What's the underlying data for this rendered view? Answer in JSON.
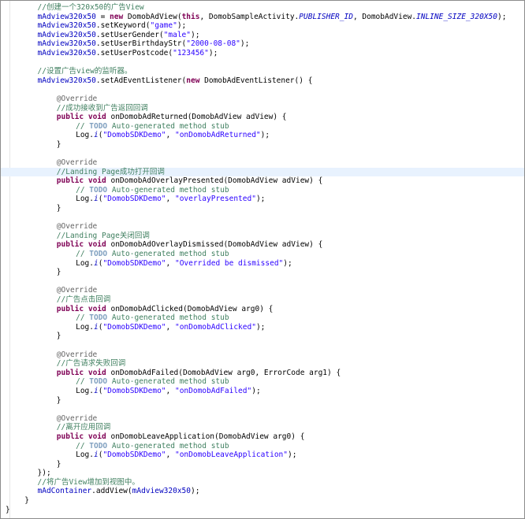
{
  "editor": {
    "lines": [
      {
        "indent": 5,
        "tokens": [
          {
            "k": "cmt",
            "t": "//创建一个320x50的广告View"
          }
        ]
      },
      {
        "indent": 5,
        "tokens": [
          {
            "k": "var",
            "t": "mAdview320x50"
          },
          {
            "k": "plain",
            "t": " = "
          },
          {
            "k": "kw",
            "t": "new"
          },
          {
            "k": "plain",
            "t": " DomobAdView("
          },
          {
            "k": "kw",
            "t": "this"
          },
          {
            "k": "plain",
            "t": ", DomobSampleActivity."
          },
          {
            "k": "field",
            "t": "PUBLISHER_ID"
          },
          {
            "k": "plain",
            "t": ", DomobAdView."
          },
          {
            "k": "field",
            "t": "INLINE_SIZE_320X50"
          },
          {
            "k": "plain",
            "t": ");"
          }
        ]
      },
      {
        "indent": 5,
        "tokens": [
          {
            "k": "var",
            "t": "mAdview320x50"
          },
          {
            "k": "plain",
            "t": ".setKeyword("
          },
          {
            "k": "str",
            "t": "\"game\""
          },
          {
            "k": "plain",
            "t": ");"
          }
        ]
      },
      {
        "indent": 5,
        "tokens": [
          {
            "k": "var",
            "t": "mAdview320x50"
          },
          {
            "k": "plain",
            "t": ".setUserGender("
          },
          {
            "k": "str",
            "t": "\"male\""
          },
          {
            "k": "plain",
            "t": ");"
          }
        ]
      },
      {
        "indent": 5,
        "tokens": [
          {
            "k": "var",
            "t": "mAdview320x50"
          },
          {
            "k": "plain",
            "t": ".setUserBirthdayStr("
          },
          {
            "k": "str",
            "t": "\"2000-08-08\""
          },
          {
            "k": "plain",
            "t": ");"
          }
        ]
      },
      {
        "indent": 5,
        "tokens": [
          {
            "k": "var",
            "t": "mAdview320x50"
          },
          {
            "k": "plain",
            "t": ".setUserPostcode("
          },
          {
            "k": "str",
            "t": "\"123456\""
          },
          {
            "k": "plain",
            "t": ");"
          }
        ]
      },
      {
        "indent": 0,
        "tokens": []
      },
      {
        "indent": 5,
        "tokens": [
          {
            "k": "cmt",
            "t": "//设置广告view的监听器。"
          }
        ]
      },
      {
        "indent": 5,
        "tokens": [
          {
            "k": "var",
            "t": "mAdview320x50"
          },
          {
            "k": "plain",
            "t": ".setAdEventListener("
          },
          {
            "k": "kw",
            "t": "new"
          },
          {
            "k": "plain",
            "t": " DomobAdEventListener() {"
          }
        ]
      },
      {
        "indent": 0,
        "tokens": []
      },
      {
        "indent": 8,
        "tokens": [
          {
            "k": "ann",
            "t": "@Override"
          }
        ]
      },
      {
        "indent": 8,
        "tokens": [
          {
            "k": "cmt",
            "t": "//成功接收到广告返回回调"
          }
        ]
      },
      {
        "indent": 8,
        "tokens": [
          {
            "k": "kw",
            "t": "public"
          },
          {
            "k": "plain",
            "t": " "
          },
          {
            "k": "kw",
            "t": "void"
          },
          {
            "k": "plain",
            "t": " onDomobAdReturned(DomobAdView adView) {"
          }
        ]
      },
      {
        "indent": 11,
        "tokens": [
          {
            "k": "cmt",
            "t": "// "
          },
          {
            "k": "todo",
            "t": "TODO"
          },
          {
            "k": "cmt",
            "t": " Auto-generated method stub"
          }
        ]
      },
      {
        "indent": 11,
        "tokens": [
          {
            "k": "plain",
            "t": "Log."
          },
          {
            "k": "field",
            "t": "i"
          },
          {
            "k": "plain",
            "t": "("
          },
          {
            "k": "str",
            "t": "\"DomobSDKDemo\""
          },
          {
            "k": "plain",
            "t": ", "
          },
          {
            "k": "str",
            "t": "\"onDomobAdReturned\""
          },
          {
            "k": "plain",
            "t": ");"
          }
        ]
      },
      {
        "indent": 8,
        "tokens": [
          {
            "k": "plain",
            "t": "}"
          }
        ]
      },
      {
        "indent": 0,
        "tokens": []
      },
      {
        "indent": 8,
        "tokens": [
          {
            "k": "ann",
            "t": "@Override"
          }
        ]
      },
      {
        "indent": 8,
        "hl": true,
        "tokens": [
          {
            "k": "cmt",
            "t": "//Landing Page成功打开回调"
          }
        ]
      },
      {
        "indent": 8,
        "tokens": [
          {
            "k": "kw",
            "t": "public"
          },
          {
            "k": "plain",
            "t": " "
          },
          {
            "k": "kw",
            "t": "void"
          },
          {
            "k": "plain",
            "t": " onDomobAdOverlayPresented(DomobAdView adView) {"
          }
        ]
      },
      {
        "indent": 11,
        "tokens": [
          {
            "k": "cmt",
            "t": "// "
          },
          {
            "k": "todo",
            "t": "TODO"
          },
          {
            "k": "cmt",
            "t": " Auto-generated method stub"
          }
        ]
      },
      {
        "indent": 11,
        "tokens": [
          {
            "k": "plain",
            "t": "Log."
          },
          {
            "k": "field",
            "t": "i"
          },
          {
            "k": "plain",
            "t": "("
          },
          {
            "k": "str",
            "t": "\"DomobSDKDemo\""
          },
          {
            "k": "plain",
            "t": ", "
          },
          {
            "k": "str",
            "t": "\"overlayPresented\""
          },
          {
            "k": "plain",
            "t": ");"
          }
        ]
      },
      {
        "indent": 8,
        "tokens": [
          {
            "k": "plain",
            "t": "}"
          }
        ]
      },
      {
        "indent": 0,
        "tokens": []
      },
      {
        "indent": 8,
        "tokens": [
          {
            "k": "ann",
            "t": "@Override"
          }
        ]
      },
      {
        "indent": 8,
        "tokens": [
          {
            "k": "cmt",
            "t": "//Landing Page关闭回调"
          }
        ]
      },
      {
        "indent": 8,
        "tokens": [
          {
            "k": "kw",
            "t": "public"
          },
          {
            "k": "plain",
            "t": " "
          },
          {
            "k": "kw",
            "t": "void"
          },
          {
            "k": "plain",
            "t": " onDomobAdOverlayDismissed(DomobAdView adView) {"
          }
        ]
      },
      {
        "indent": 11,
        "tokens": [
          {
            "k": "cmt",
            "t": "// "
          },
          {
            "k": "todo",
            "t": "TODO"
          },
          {
            "k": "cmt",
            "t": " Auto-generated method stub"
          }
        ]
      },
      {
        "indent": 11,
        "tokens": [
          {
            "k": "plain",
            "t": "Log."
          },
          {
            "k": "field",
            "t": "i"
          },
          {
            "k": "plain",
            "t": "("
          },
          {
            "k": "str",
            "t": "\"DomobSDKDemo\""
          },
          {
            "k": "plain",
            "t": ", "
          },
          {
            "k": "str",
            "t": "\"Overrided be dismissed\""
          },
          {
            "k": "plain",
            "t": ");"
          }
        ]
      },
      {
        "indent": 8,
        "tokens": [
          {
            "k": "plain",
            "t": "}"
          }
        ]
      },
      {
        "indent": 0,
        "tokens": []
      },
      {
        "indent": 8,
        "tokens": [
          {
            "k": "ann",
            "t": "@Override"
          }
        ]
      },
      {
        "indent": 8,
        "tokens": [
          {
            "k": "cmt",
            "t": "//广告点击回调"
          }
        ]
      },
      {
        "indent": 8,
        "tokens": [
          {
            "k": "kw",
            "t": "public"
          },
          {
            "k": "plain",
            "t": " "
          },
          {
            "k": "kw",
            "t": "void"
          },
          {
            "k": "plain",
            "t": " onDomobAdClicked(DomobAdView arg0) {"
          }
        ]
      },
      {
        "indent": 11,
        "tokens": [
          {
            "k": "cmt",
            "t": "// "
          },
          {
            "k": "todo",
            "t": "TODO"
          },
          {
            "k": "cmt",
            "t": " Auto-generated method stub"
          }
        ]
      },
      {
        "indent": 11,
        "tokens": [
          {
            "k": "plain",
            "t": "Log."
          },
          {
            "k": "field",
            "t": "i"
          },
          {
            "k": "plain",
            "t": "("
          },
          {
            "k": "str",
            "t": "\"DomobSDKDemo\""
          },
          {
            "k": "plain",
            "t": ", "
          },
          {
            "k": "str",
            "t": "\"onDomobAdClicked\""
          },
          {
            "k": "plain",
            "t": ");"
          }
        ]
      },
      {
        "indent": 8,
        "tokens": [
          {
            "k": "plain",
            "t": "}"
          }
        ]
      },
      {
        "indent": 0,
        "tokens": []
      },
      {
        "indent": 8,
        "tokens": [
          {
            "k": "ann",
            "t": "@Override"
          }
        ]
      },
      {
        "indent": 8,
        "tokens": [
          {
            "k": "cmt",
            "t": "//广告请求失败回调"
          }
        ]
      },
      {
        "indent": 8,
        "tokens": [
          {
            "k": "kw",
            "t": "public"
          },
          {
            "k": "plain",
            "t": " "
          },
          {
            "k": "kw",
            "t": "void"
          },
          {
            "k": "plain",
            "t": " onDomobAdFailed(DomobAdView arg0, ErrorCode arg1) {"
          }
        ]
      },
      {
        "indent": 11,
        "tokens": [
          {
            "k": "cmt",
            "t": "// "
          },
          {
            "k": "todo",
            "t": "TODO"
          },
          {
            "k": "cmt",
            "t": " Auto-generated method stub"
          }
        ]
      },
      {
        "indent": 11,
        "tokens": [
          {
            "k": "plain",
            "t": "Log."
          },
          {
            "k": "field",
            "t": "i"
          },
          {
            "k": "plain",
            "t": "("
          },
          {
            "k": "str",
            "t": "\"DomobSDKDemo\""
          },
          {
            "k": "plain",
            "t": ", "
          },
          {
            "k": "str",
            "t": "\"onDomobAdFailed\""
          },
          {
            "k": "plain",
            "t": ");"
          }
        ]
      },
      {
        "indent": 8,
        "tokens": [
          {
            "k": "plain",
            "t": "}"
          }
        ]
      },
      {
        "indent": 0,
        "tokens": []
      },
      {
        "indent": 8,
        "tokens": [
          {
            "k": "ann",
            "t": "@Override"
          }
        ]
      },
      {
        "indent": 8,
        "tokens": [
          {
            "k": "cmt",
            "t": "//离开应用回调"
          }
        ]
      },
      {
        "indent": 8,
        "tokens": [
          {
            "k": "kw",
            "t": "public"
          },
          {
            "k": "plain",
            "t": " "
          },
          {
            "k": "kw",
            "t": "void"
          },
          {
            "k": "plain",
            "t": " onDomobLeaveApplication(DomobAdView arg0) {"
          }
        ]
      },
      {
        "indent": 11,
        "tokens": [
          {
            "k": "cmt",
            "t": "// "
          },
          {
            "k": "todo",
            "t": "TODO"
          },
          {
            "k": "cmt",
            "t": " Auto-generated method stub"
          }
        ]
      },
      {
        "indent": 11,
        "tokens": [
          {
            "k": "plain",
            "t": "Log."
          },
          {
            "k": "field",
            "t": "i"
          },
          {
            "k": "plain",
            "t": "("
          },
          {
            "k": "str",
            "t": "\"DomobSDKDemo\""
          },
          {
            "k": "plain",
            "t": ", "
          },
          {
            "k": "str",
            "t": "\"onDomobLeaveApplication\""
          },
          {
            "k": "plain",
            "t": ");"
          }
        ]
      },
      {
        "indent": 8,
        "tokens": [
          {
            "k": "plain",
            "t": "}"
          }
        ]
      },
      {
        "indent": 5,
        "tokens": [
          {
            "k": "plain",
            "t": "});"
          }
        ]
      },
      {
        "indent": 5,
        "tokens": [
          {
            "k": "cmt",
            "t": "//将广告View增加到视图中。"
          }
        ]
      },
      {
        "indent": 5,
        "tokens": [
          {
            "k": "var",
            "t": "mAdContainer"
          },
          {
            "k": "plain",
            "t": ".addView("
          },
          {
            "k": "var",
            "t": "mAdview320x50"
          },
          {
            "k": "plain",
            "t": ");"
          }
        ]
      },
      {
        "indent": 3,
        "tokens": [
          {
            "k": "plain",
            "t": "}"
          }
        ]
      },
      {
        "indent": 0,
        "tokens": [
          {
            "k": "plain",
            "t": "}"
          }
        ]
      }
    ]
  }
}
